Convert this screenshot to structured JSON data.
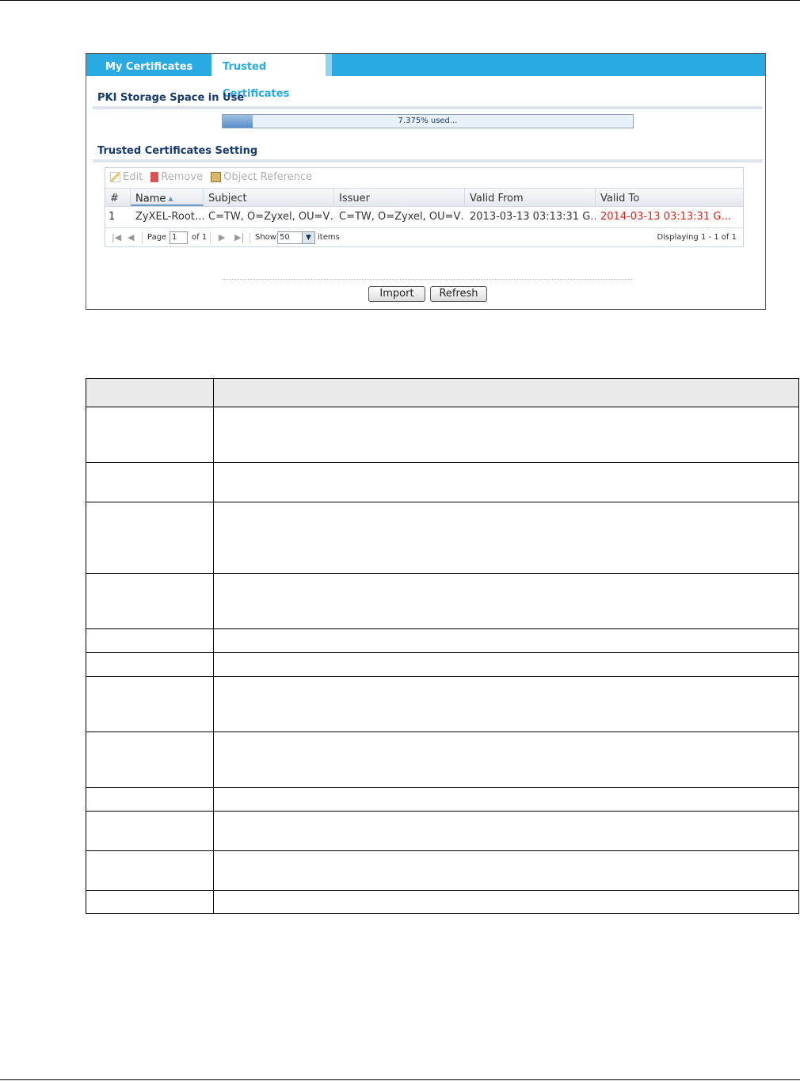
{
  "tabs": [
    {
      "label": "My Certificates",
      "active": false
    },
    {
      "label": "Trusted Certificates",
      "active": true
    }
  ],
  "storage": {
    "title": "PKI Storage Space in Use",
    "used_percent": 7.375,
    "text": "7.375% used..."
  },
  "settings": {
    "title": "Trusted Certificates Setting",
    "toolbar": {
      "edit": "Edit",
      "remove": "Remove",
      "object_reference": "Object Reference"
    },
    "columns": [
      "#",
      "Name",
      "Subject",
      "Issuer",
      "Valid From",
      "Valid To"
    ],
    "rows": [
      {
        "index": "1",
        "name": "ZyXEL-Root…",
        "subject": "C=TW, O=Zyxel, OU=V…",
        "issuer": "C=TW, O=Zyxel, OU=V…",
        "valid_from": "2013-03-13 03:13:31 G…",
        "valid_to": "2014-03-13 03:13:31 G…"
      }
    ],
    "pager": {
      "page_label": "Page",
      "page_value": "1",
      "of_label": "of 1",
      "show_label": "Show",
      "show_value": "50",
      "items_label": "items",
      "displaying": "Displaying 1 - 1 of 1"
    }
  },
  "buttons": {
    "import": "Import",
    "refresh": "Refresh"
  },
  "colors": {
    "tab_bar": "#29abe2",
    "section_title": "#143a6e",
    "expired_date": "#d9261c"
  }
}
